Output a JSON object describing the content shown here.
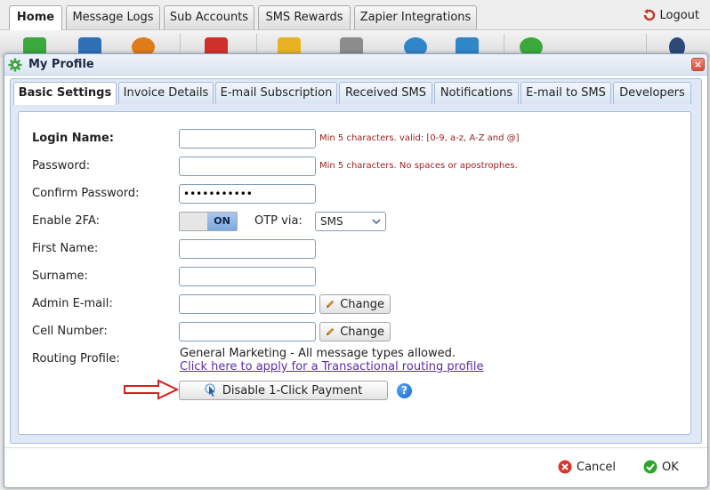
{
  "app": {
    "tabs": [
      {
        "label": "Home"
      },
      {
        "label": "Message Logs"
      },
      {
        "label": "Sub Accounts"
      },
      {
        "label": "SMS Rewards"
      },
      {
        "label": "Zapier Integrations"
      }
    ],
    "logout_label": "Logout"
  },
  "dialog": {
    "title": "My Profile",
    "close_label": "×",
    "tabs": [
      {
        "label": "Basic Settings"
      },
      {
        "label": "Invoice Details"
      },
      {
        "label": "E-mail Subscription"
      },
      {
        "label": "Received SMS"
      },
      {
        "label": "Notifications"
      },
      {
        "label": "E-mail to SMS"
      },
      {
        "label": "Developers"
      }
    ],
    "active_tab": "Basic Settings",
    "cancel_label": "Cancel",
    "ok_label": "OK"
  },
  "form": {
    "login_name": {
      "label": "Login Name:",
      "value": "",
      "hint": "Min 5 characters. valid: [0-9, a-z, A-Z and @]"
    },
    "password": {
      "label": "Password:",
      "value": "",
      "hint": "Min 5 characters. No spaces or apostrophes."
    },
    "confirm_password": {
      "label": "Confirm Password:",
      "value": "•••••••••••"
    },
    "enable_2fa": {
      "label": "Enable 2FA:",
      "state": "ON"
    },
    "otp_via": {
      "label": "OTP via:",
      "value": "SMS"
    },
    "first_name": {
      "label": "First Name:",
      "value": ""
    },
    "surname": {
      "label": "Surname:",
      "value": ""
    },
    "admin_email": {
      "label": "Admin E-mail:",
      "value": "",
      "change_label": "Change"
    },
    "cell_number": {
      "label": "Cell Number:",
      "value": "",
      "change_label": "Change"
    },
    "routing_profile": {
      "label": "Routing Profile:",
      "text": "General Marketing - All message types allowed.",
      "link": "Click here to apply for a Transactional routing profile"
    },
    "one_click": {
      "label": "Disable 1-Click Payment"
    },
    "help_label": "?"
  },
  "colors": {
    "hint_red": "#9b1c1c",
    "link_purple": "#5b2ea6",
    "toggle_blue": "#7fa9dd",
    "arrow_red": "#d61f1f",
    "help_blue": "#1565c8"
  }
}
